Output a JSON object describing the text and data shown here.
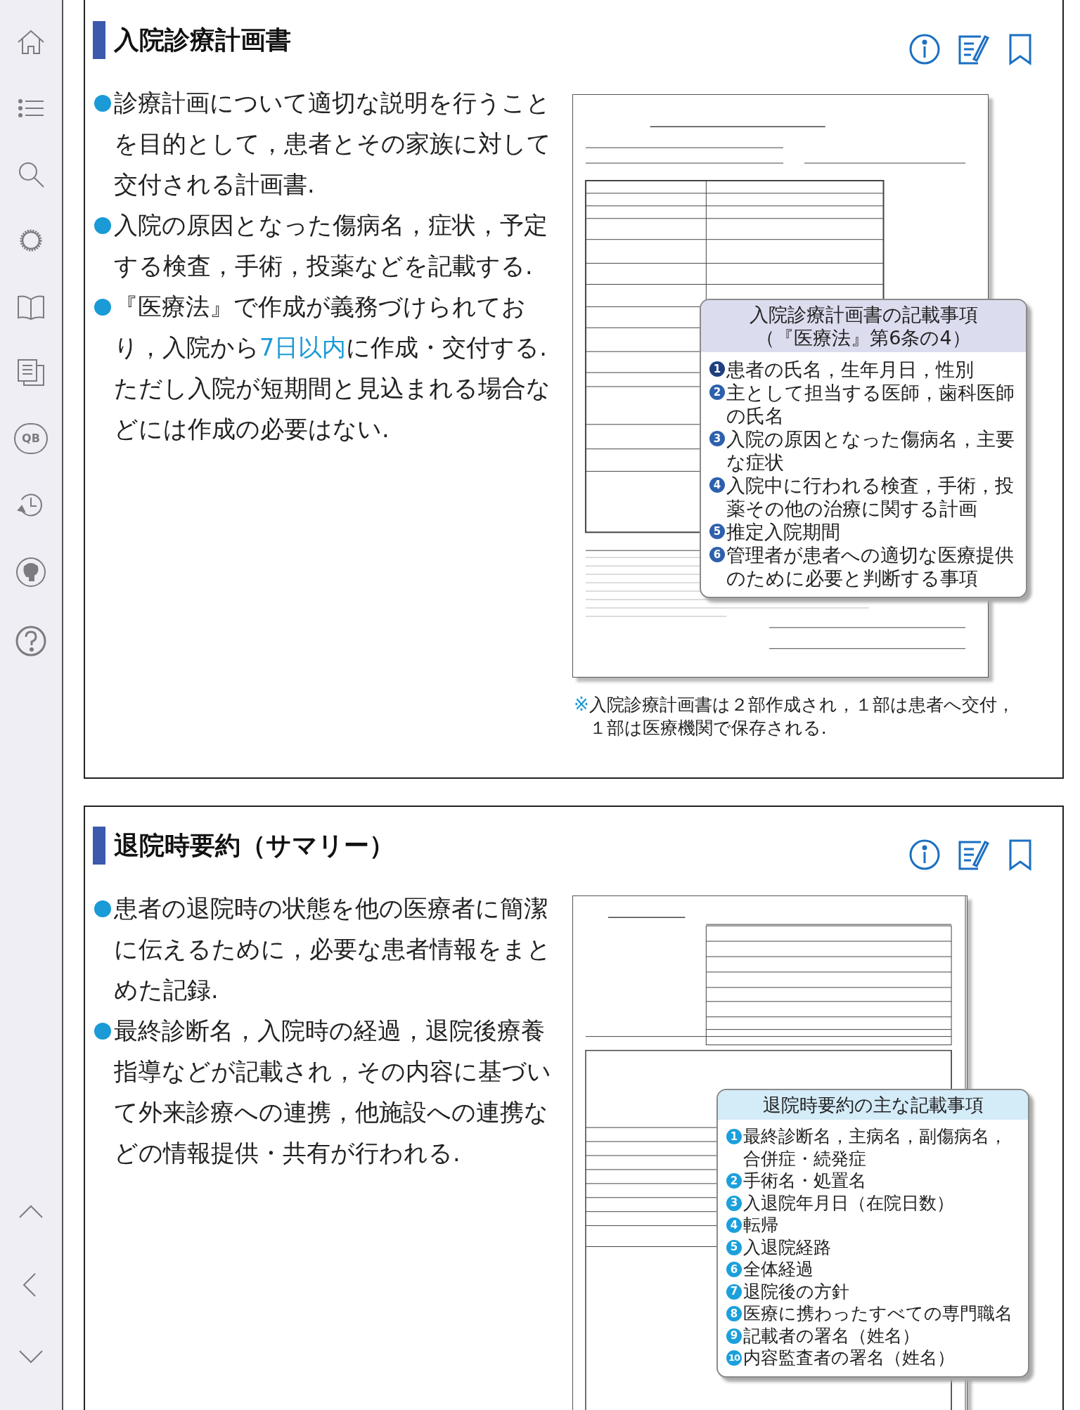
{
  "sidebar": {
    "items": [
      {
        "kind": "home"
      },
      {
        "kind": "list"
      },
      {
        "kind": "search"
      },
      {
        "kind": "settings"
      },
      {
        "kind": "book"
      },
      {
        "kind": "copy"
      },
      {
        "kind": "sync",
        "label": "QB"
      },
      {
        "kind": "history"
      },
      {
        "kind": "elephant"
      },
      {
        "kind": "help"
      }
    ],
    "nav": [
      {
        "kind": "up"
      },
      {
        "kind": "left"
      },
      {
        "kind": "down"
      }
    ]
  },
  "sections": [
    {
      "title": "入院診療計画書",
      "paragraphs": [
        {
          "segments": [
            {
              "text": "診療計画について適切な説明を行うことを目的として，患者とその家族に対して交付される計画書.",
              "highlight": false
            }
          ]
        },
        {
          "segments": [
            {
              "text": "入院の原因となった傷病名，症状，予定する検査，手術，投薬などを記載する.",
              "highlight": false
            }
          ]
        },
        {
          "segments": [
            {
              "text": "『医療法』で作成が義務づけられており，入院から",
              "highlight": false
            },
            {
              "text": "7日以内",
              "highlight": true
            },
            {
              "text": "に作成・交付する.ただし入院が短期間と見込まれる場合などには作成の必要はない.",
              "highlight": false
            }
          ]
        }
      ],
      "figure": {
        "kind": "plan",
        "callout": {
          "title_lines": [
            "入院診療計画書の記載事項",
            "（『医療法』第6条の4）"
          ],
          "items": [
            {
              "number": "1",
              "text": "患者の氏名，生年月日，性別"
            },
            {
              "number": "2",
              "text": "主として担当する医師，歯科医師の氏名"
            },
            {
              "number": "3",
              "text": "入院の原因となった傷病名，主要な症状"
            },
            {
              "number": "4",
              "text": "入院中に行われる検査，手術，投薬その他の治療に関する計画"
            },
            {
              "number": "5",
              "text": "推定入院期間"
            },
            {
              "number": "6",
              "text": "管理者が患者への適切な医療提供のために必要と判断する事項"
            }
          ]
        },
        "caption": {
          "mark": "※",
          "lines": [
            "入院診療計画書は２部作成され，１部は患者へ交付，",
            "１部は医療機関で保存される."
          ]
        }
      }
    },
    {
      "title": "退院時要約（サマリー）",
      "paragraphs": [
        {
          "segments": [
            {
              "text": "患者の退院時の状態を他の医療者に簡潔に伝えるために，必要な患者情報をまとめた記録.",
              "highlight": false
            }
          ]
        },
        {
          "segments": [
            {
              "text": "最終診断名，入院時の経過，退院後療養指導などが記載され，その内容に基づいて外来診療への連携，他施設への連携などの情報提供・共有が行われる.",
              "highlight": false
            }
          ]
        }
      ],
      "figure": {
        "kind": "summary",
        "callout": {
          "title_lines": [
            "退院時要約の主な記載事項"
          ],
          "items": [
            {
              "number": "1",
              "text": "最終診断名，主病名，副傷病名，合併症・続発症"
            },
            {
              "number": "2",
              "text": "手術名・処置名"
            },
            {
              "number": "3",
              "text": "入退院年月日（在院日数）"
            },
            {
              "number": "4",
              "text": "転帰"
            },
            {
              "number": "5",
              "text": "入退院経路"
            },
            {
              "number": "6",
              "text": "全体経過"
            },
            {
              "number": "7",
              "text": "退院後の方針"
            },
            {
              "number": "8",
              "text": "医療に携わったすべての専門職名"
            },
            {
              "number": "9",
              "text": "記載者の署名（姓名）"
            },
            {
              "number": "10",
              "text": "内容監査者の署名（姓名）"
            }
          ]
        }
      }
    }
  ]
}
